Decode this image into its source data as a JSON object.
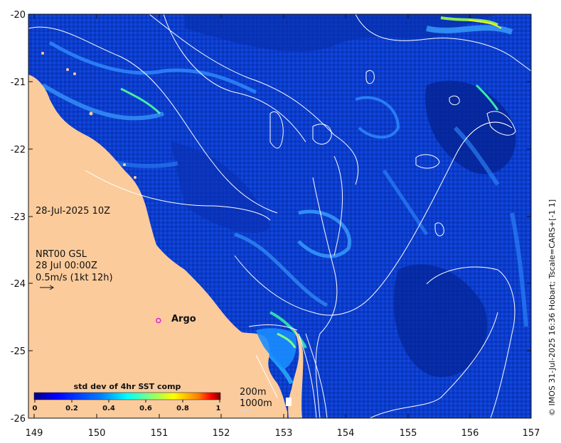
{
  "axes": {
    "x_ticks": [
      "149",
      "150",
      "151",
      "152",
      "153",
      "154",
      "155",
      "156",
      "157"
    ],
    "y_ticks": [
      "-20",
      "-21",
      "-22",
      "-23",
      "-24",
      "-25",
      "-26"
    ]
  },
  "annotations": {
    "date_time": "28-Jul-2025 10Z",
    "product": "NRT00 GSL",
    "current_time": "28 Jul 00:00Z",
    "vector_scale": "0.5m/s (1kt 12h)",
    "argo_label": "Argo",
    "isobath_200": "200m",
    "isobath_1000": "1000m"
  },
  "colorbar": {
    "title": "std dev of 4hr SST comp",
    "ticks": [
      "0",
      "0.2",
      "0.4",
      "0.6",
      "0.8",
      "1"
    ],
    "colors": [
      "#00007f",
      "#0000ff",
      "#007fff",
      "#00ffff",
      "#7fff7f",
      "#ffff00",
      "#ff7f00",
      "#ff0000",
      "#7f0000"
    ]
  },
  "credit": "© IMOS 31-Jul-2025 16:36 Hobart; Tscale=CARS+[-1 1]",
  "colors": {
    "land": "#fbcb9c",
    "ocean_base": "#0a3bd0",
    "contour": "#ffffff",
    "argo_marker": "#e020e0"
  },
  "map_data": {
    "lon_range": [
      149,
      157
    ],
    "lat_range": [
      -26,
      -20
    ],
    "argo_float": {
      "lon": 151.0,
      "lat": -24.55
    }
  }
}
